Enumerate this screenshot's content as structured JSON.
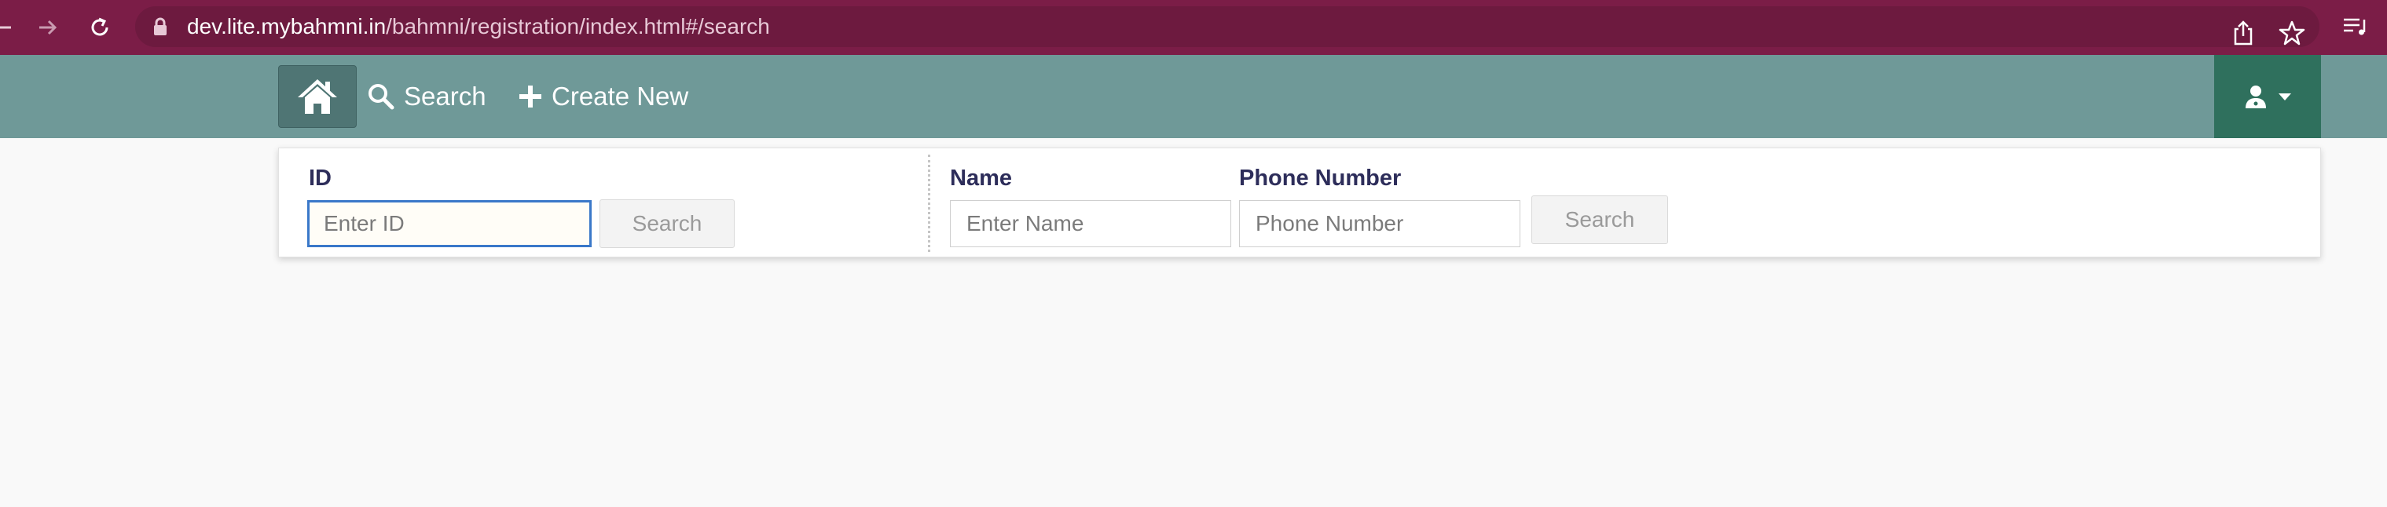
{
  "browser": {
    "url_domain": "dev.lite.mybahmni.in",
    "url_path": "/bahmni/registration/index.html#/search",
    "bar_color": "#7b1d47"
  },
  "header": {
    "color": "#6f9998",
    "nav": {
      "home_icon": "home-icon",
      "search_label": "Search",
      "create_new_label": "Create New"
    },
    "user_menu_icon": "user-doctor-icon"
  },
  "search": {
    "id_section": {
      "label": "ID",
      "placeholder": "Enter ID",
      "button_label": "Search"
    },
    "name_section": {
      "name_label": "Name",
      "name_placeholder": "Enter Name",
      "phone_label": "Phone Number",
      "phone_placeholder": "Phone Number",
      "button_label": "Search"
    }
  }
}
